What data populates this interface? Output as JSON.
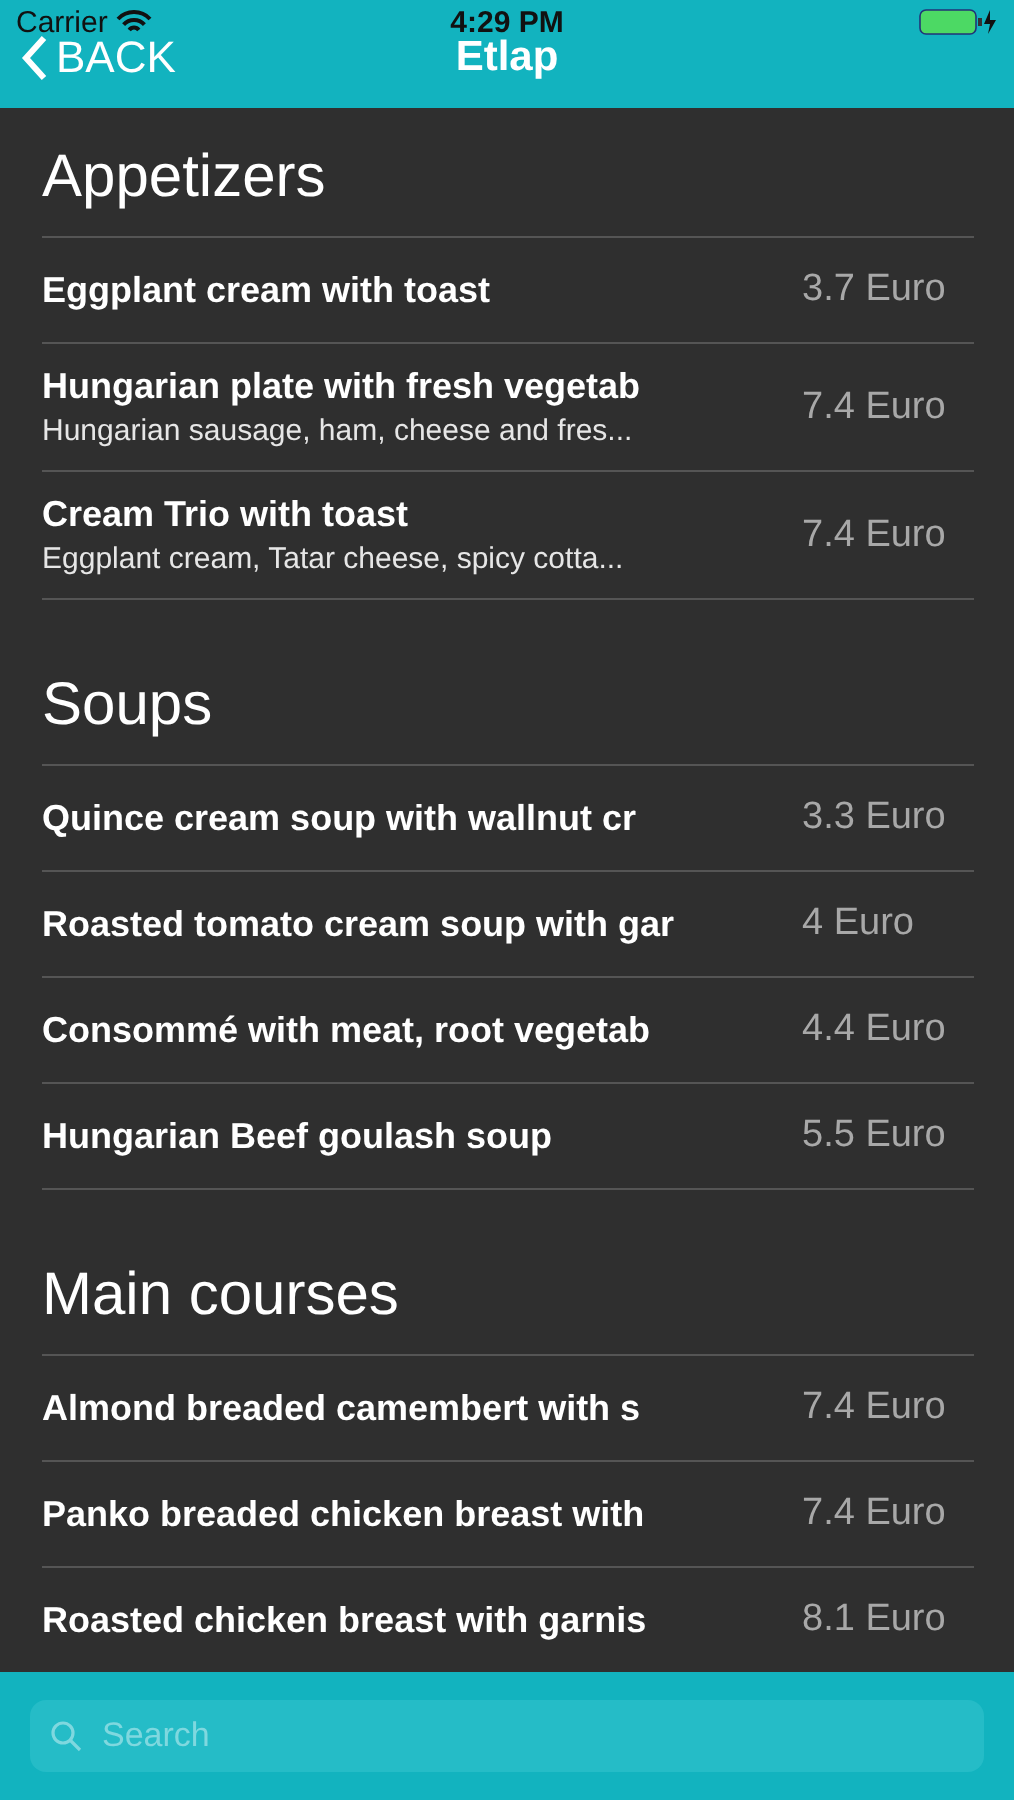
{
  "status_bar": {
    "carrier": "Carrier",
    "time": "4:29 PM"
  },
  "nav": {
    "back": "BACK",
    "title": "Etlap"
  },
  "sections": [
    {
      "title": "Appetizers",
      "items": [
        {
          "name": "Eggplant cream with toast",
          "price": "3.7 Euro"
        },
        {
          "name": "Hungarian plate with fresh vegetab",
          "description": "Hungarian sausage, ham, cheese and fres...",
          "price": "7.4 Euro"
        },
        {
          "name": "Cream Trio with toast",
          "description": "Eggplant cream, Tatar cheese, spicy cotta...",
          "price": "7.4 Euro"
        }
      ]
    },
    {
      "title": "Soups",
      "items": [
        {
          "name": "Quince cream soup with wallnut cr",
          "price": "3.3 Euro"
        },
        {
          "name": "Roasted tomato cream soup with gar",
          "price": "4 Euro"
        },
        {
          "name": "Consommé with meat, root vegetab",
          "price": "4.4 Euro"
        },
        {
          "name": "Hungarian Beef goulash soup",
          "price": "5.5 Euro"
        }
      ]
    },
    {
      "title": "Main courses",
      "items": [
        {
          "name": "Almond breaded camembert with s",
          "price": "7.4 Euro"
        },
        {
          "name": "Panko breaded chicken breast with",
          "price": "7.4 Euro"
        },
        {
          "name": "Roasted chicken breast with garnis",
          "price": "8.1 Euro"
        }
      ]
    }
  ],
  "search": {
    "placeholder": "Search"
  }
}
